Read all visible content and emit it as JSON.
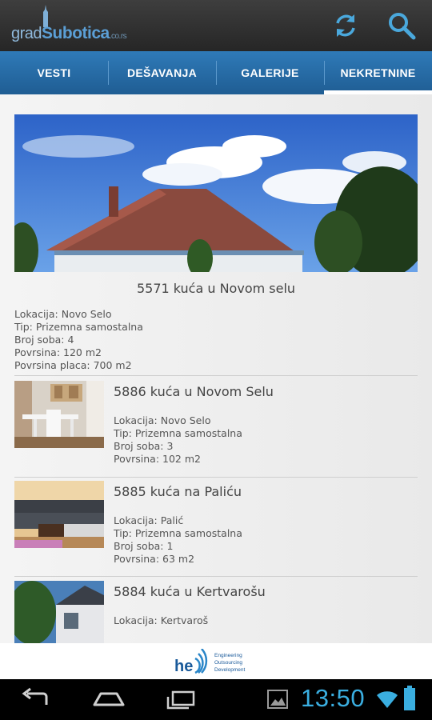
{
  "app": {
    "logo_prefix": "grad",
    "logo_main": "Subotica",
    "logo_suffix": ".co.rs",
    "actions": [
      "refresh-icon",
      "search-icon"
    ]
  },
  "tabs": [
    {
      "label": "VESTI"
    },
    {
      "label": "DEŠAVANJA"
    },
    {
      "label": "GALERIJE"
    },
    {
      "label": "NEKRETNINE",
      "active": true
    }
  ],
  "featured": {
    "title": "5571 kuća u Novom selu",
    "details": [
      "Lokacija: Novo Selo",
      "Tip: Prizemna samostalna",
      "Broj soba: 4",
      "Povrsina: 120 m2",
      "Povrsina placa: 700 m2"
    ]
  },
  "listings": [
    {
      "title": "5886 kuća u Novom Selu",
      "details": [
        "Lokacija: Novo Selo",
        "Tip: Prizemna samostalna",
        "Broj soba: 3",
        "Povrsina: 102 m2"
      ]
    },
    {
      "title": "5885 kuća na Paliću",
      "details": [
        "Lokacija: Palić",
        "Tip: Prizemna samostalna",
        "Broj soba: 1",
        "Povrsina: 63 m2"
      ]
    },
    {
      "title": "5884 kuća u Kertvarošu",
      "details": [
        "Lokacija: Kertvaroš"
      ]
    }
  ],
  "ad": {
    "brand": "he",
    "lines": [
      "Engineering",
      "Outsourcing",
      "Development"
    ]
  },
  "status": {
    "time": "13:50"
  },
  "colors": {
    "tab_bar": "#2a6fab",
    "action_bar": "#2d2d2d",
    "accent_icon": "#4aa8dc",
    "clock": "#3aaee0"
  }
}
